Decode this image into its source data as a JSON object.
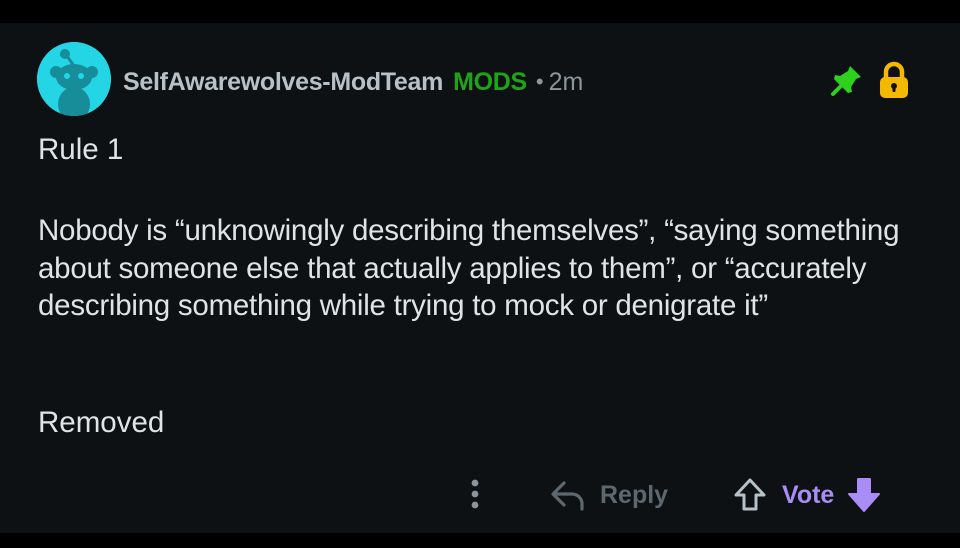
{
  "comment": {
    "author": "SelfAwarewolves-ModTeam",
    "flair": "MODS",
    "separator": "•",
    "timestamp": "2m",
    "title_line": "Rule 1",
    "body_paragraph": "Nobody is “unknowingly describing themselves”, “saying something about someone else that actually applies to them”, or “accurately describing something while trying to mock or denigrate it”",
    "footer_line": "Removed"
  },
  "actions": {
    "more_icon": "vertical-dots-icon",
    "reply_label": "Reply",
    "reply_icon": "reply-arrow-icon",
    "upvote_icon": "upvote-arrow-icon",
    "vote_label": "Vote",
    "downvote_icon": "downvote-arrow-icon"
  },
  "status_icons": {
    "pinned": "pin-icon",
    "locked": "lock-icon"
  },
  "colors": {
    "background": "#0e1113",
    "author": "#b6c1c8",
    "mod_flair": "#1fa317",
    "body_text": "#dfe4e7",
    "avatar": "#24d5e6",
    "pin": "#2fd11f",
    "lock": "#f5b800",
    "vote_accent": "#a98cf5",
    "muted": "#5d676e"
  }
}
